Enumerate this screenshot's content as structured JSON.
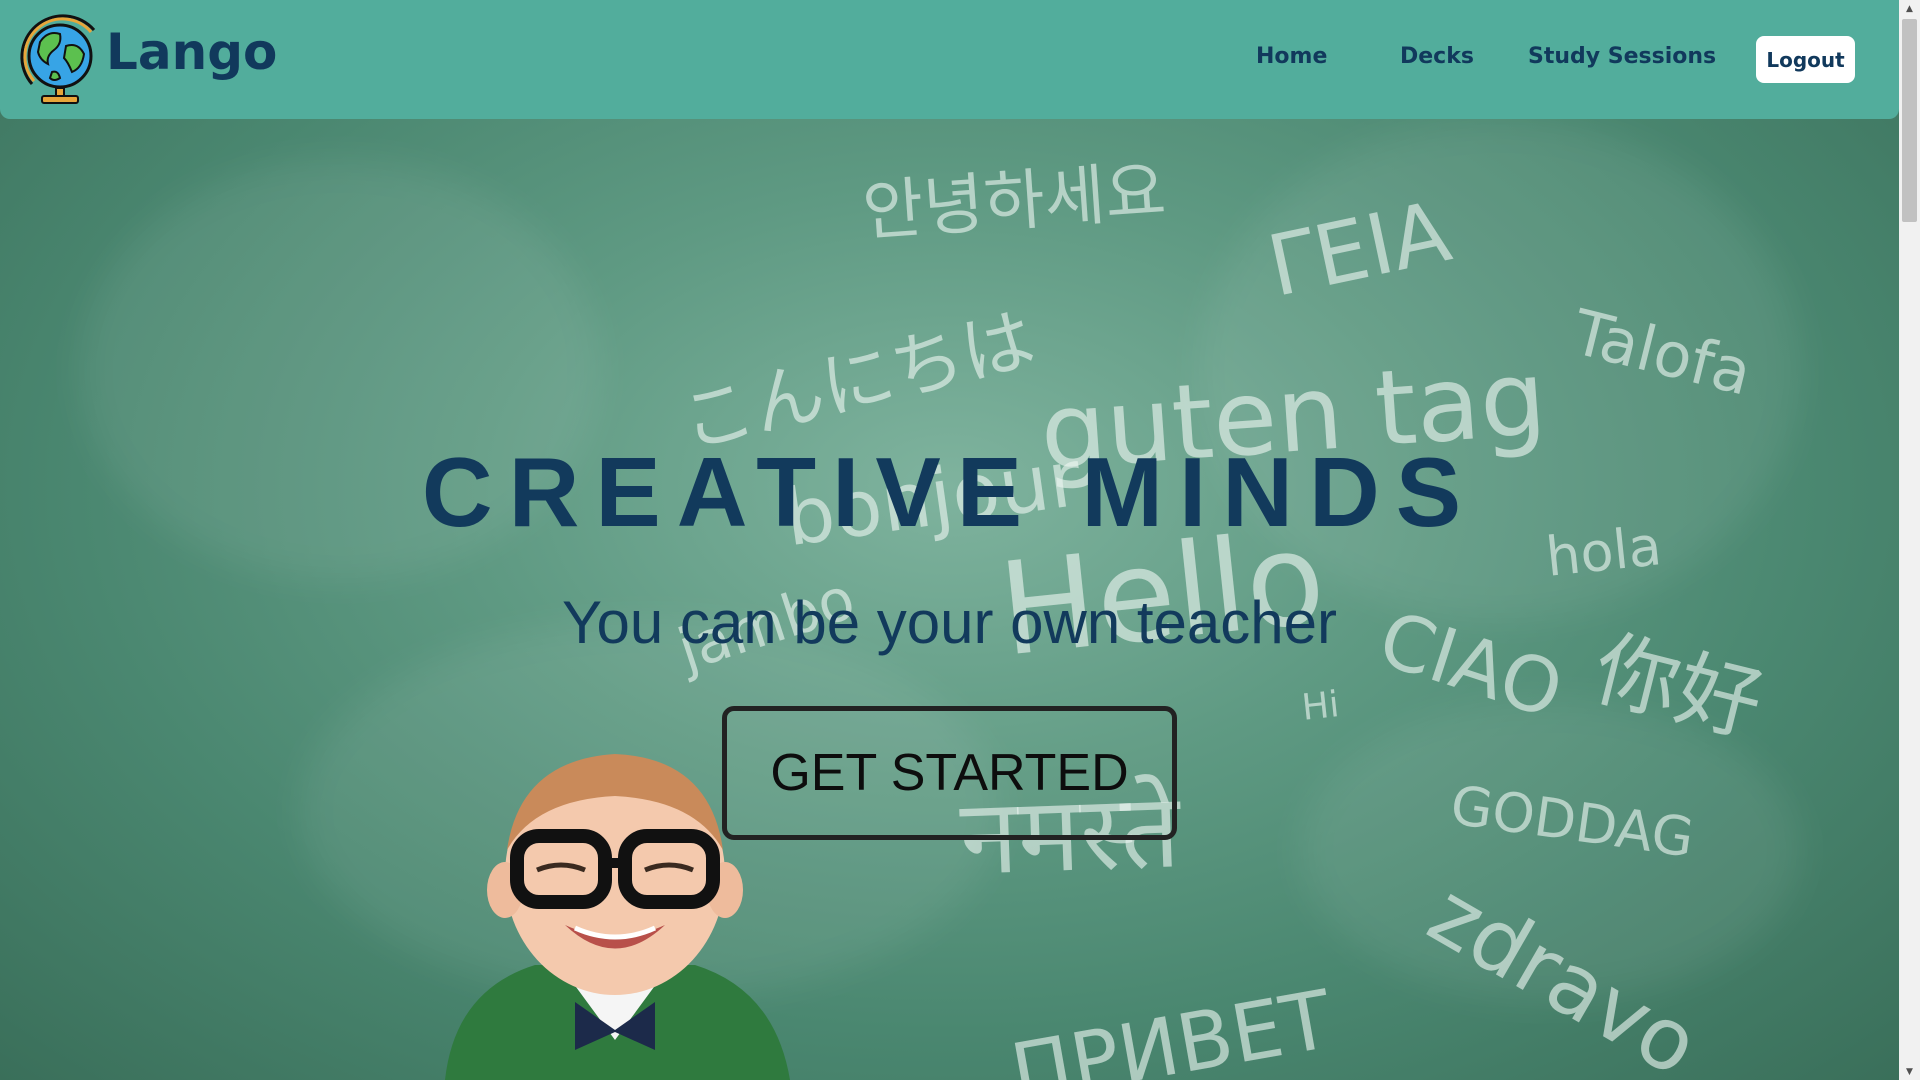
{
  "app": {
    "brand_name": "Lango"
  },
  "nav": {
    "links": [
      "Home",
      "Decks",
      "Study Sessions"
    ],
    "logout_label": "Logout"
  },
  "hero": {
    "title": "CREATIVE MINDS",
    "subtitle": "You can be your own teacher",
    "cta_label": "GET STARTED"
  },
  "chalkboard_words": {
    "korean": "안녕하세요",
    "greek": "ΓΕΙΑ",
    "samoan": "Talofa",
    "japanese": "こんにちは",
    "german": "guten tag",
    "french": "bonjour",
    "english": "Hello",
    "spanish": "hola",
    "italian": "CIAO",
    "chinese": "你好",
    "swahili": "jambo",
    "hi": "Hi",
    "hindi": "नमस्ते",
    "danish": "GODDAG",
    "slavic": "zdravo",
    "russian": "ПРИВЕТ"
  },
  "colors": {
    "navbar_bg": "#52ad9c",
    "brand_text": "#11395c",
    "hero_text": "#123a5c",
    "logout_bg": "#ffffff"
  }
}
